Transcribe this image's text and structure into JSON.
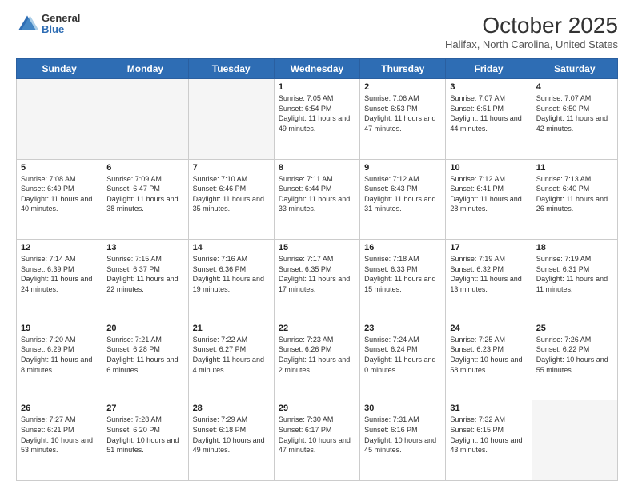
{
  "header": {
    "logo": {
      "general": "General",
      "blue": "Blue"
    },
    "title": "October 2025",
    "subtitle": "Halifax, North Carolina, United States"
  },
  "calendar": {
    "weekdays": [
      "Sunday",
      "Monday",
      "Tuesday",
      "Wednesday",
      "Thursday",
      "Friday",
      "Saturday"
    ],
    "weeks": [
      [
        {
          "day": null,
          "info": ""
        },
        {
          "day": null,
          "info": ""
        },
        {
          "day": null,
          "info": ""
        },
        {
          "day": 1,
          "info": "Sunrise: 7:05 AM\nSunset: 6:54 PM\nDaylight: 11 hours and 49 minutes."
        },
        {
          "day": 2,
          "info": "Sunrise: 7:06 AM\nSunset: 6:53 PM\nDaylight: 11 hours and 47 minutes."
        },
        {
          "day": 3,
          "info": "Sunrise: 7:07 AM\nSunset: 6:51 PM\nDaylight: 11 hours and 44 minutes."
        },
        {
          "day": 4,
          "info": "Sunrise: 7:07 AM\nSunset: 6:50 PM\nDaylight: 11 hours and 42 minutes."
        }
      ],
      [
        {
          "day": 5,
          "info": "Sunrise: 7:08 AM\nSunset: 6:49 PM\nDaylight: 11 hours and 40 minutes."
        },
        {
          "day": 6,
          "info": "Sunrise: 7:09 AM\nSunset: 6:47 PM\nDaylight: 11 hours and 38 minutes."
        },
        {
          "day": 7,
          "info": "Sunrise: 7:10 AM\nSunset: 6:46 PM\nDaylight: 11 hours and 35 minutes."
        },
        {
          "day": 8,
          "info": "Sunrise: 7:11 AM\nSunset: 6:44 PM\nDaylight: 11 hours and 33 minutes."
        },
        {
          "day": 9,
          "info": "Sunrise: 7:12 AM\nSunset: 6:43 PM\nDaylight: 11 hours and 31 minutes."
        },
        {
          "day": 10,
          "info": "Sunrise: 7:12 AM\nSunset: 6:41 PM\nDaylight: 11 hours and 28 minutes."
        },
        {
          "day": 11,
          "info": "Sunrise: 7:13 AM\nSunset: 6:40 PM\nDaylight: 11 hours and 26 minutes."
        }
      ],
      [
        {
          "day": 12,
          "info": "Sunrise: 7:14 AM\nSunset: 6:39 PM\nDaylight: 11 hours and 24 minutes."
        },
        {
          "day": 13,
          "info": "Sunrise: 7:15 AM\nSunset: 6:37 PM\nDaylight: 11 hours and 22 minutes."
        },
        {
          "day": 14,
          "info": "Sunrise: 7:16 AM\nSunset: 6:36 PM\nDaylight: 11 hours and 19 minutes."
        },
        {
          "day": 15,
          "info": "Sunrise: 7:17 AM\nSunset: 6:35 PM\nDaylight: 11 hours and 17 minutes."
        },
        {
          "day": 16,
          "info": "Sunrise: 7:18 AM\nSunset: 6:33 PM\nDaylight: 11 hours and 15 minutes."
        },
        {
          "day": 17,
          "info": "Sunrise: 7:19 AM\nSunset: 6:32 PM\nDaylight: 11 hours and 13 minutes."
        },
        {
          "day": 18,
          "info": "Sunrise: 7:19 AM\nSunset: 6:31 PM\nDaylight: 11 hours and 11 minutes."
        }
      ],
      [
        {
          "day": 19,
          "info": "Sunrise: 7:20 AM\nSunset: 6:29 PM\nDaylight: 11 hours and 8 minutes."
        },
        {
          "day": 20,
          "info": "Sunrise: 7:21 AM\nSunset: 6:28 PM\nDaylight: 11 hours and 6 minutes."
        },
        {
          "day": 21,
          "info": "Sunrise: 7:22 AM\nSunset: 6:27 PM\nDaylight: 11 hours and 4 minutes."
        },
        {
          "day": 22,
          "info": "Sunrise: 7:23 AM\nSunset: 6:26 PM\nDaylight: 11 hours and 2 minutes."
        },
        {
          "day": 23,
          "info": "Sunrise: 7:24 AM\nSunset: 6:24 PM\nDaylight: 11 hours and 0 minutes."
        },
        {
          "day": 24,
          "info": "Sunrise: 7:25 AM\nSunset: 6:23 PM\nDaylight: 10 hours and 58 minutes."
        },
        {
          "day": 25,
          "info": "Sunrise: 7:26 AM\nSunset: 6:22 PM\nDaylight: 10 hours and 55 minutes."
        }
      ],
      [
        {
          "day": 26,
          "info": "Sunrise: 7:27 AM\nSunset: 6:21 PM\nDaylight: 10 hours and 53 minutes."
        },
        {
          "day": 27,
          "info": "Sunrise: 7:28 AM\nSunset: 6:20 PM\nDaylight: 10 hours and 51 minutes."
        },
        {
          "day": 28,
          "info": "Sunrise: 7:29 AM\nSunset: 6:18 PM\nDaylight: 10 hours and 49 minutes."
        },
        {
          "day": 29,
          "info": "Sunrise: 7:30 AM\nSunset: 6:17 PM\nDaylight: 10 hours and 47 minutes."
        },
        {
          "day": 30,
          "info": "Sunrise: 7:31 AM\nSunset: 6:16 PM\nDaylight: 10 hours and 45 minutes."
        },
        {
          "day": 31,
          "info": "Sunrise: 7:32 AM\nSunset: 6:15 PM\nDaylight: 10 hours and 43 minutes."
        },
        {
          "day": null,
          "info": ""
        }
      ]
    ]
  }
}
